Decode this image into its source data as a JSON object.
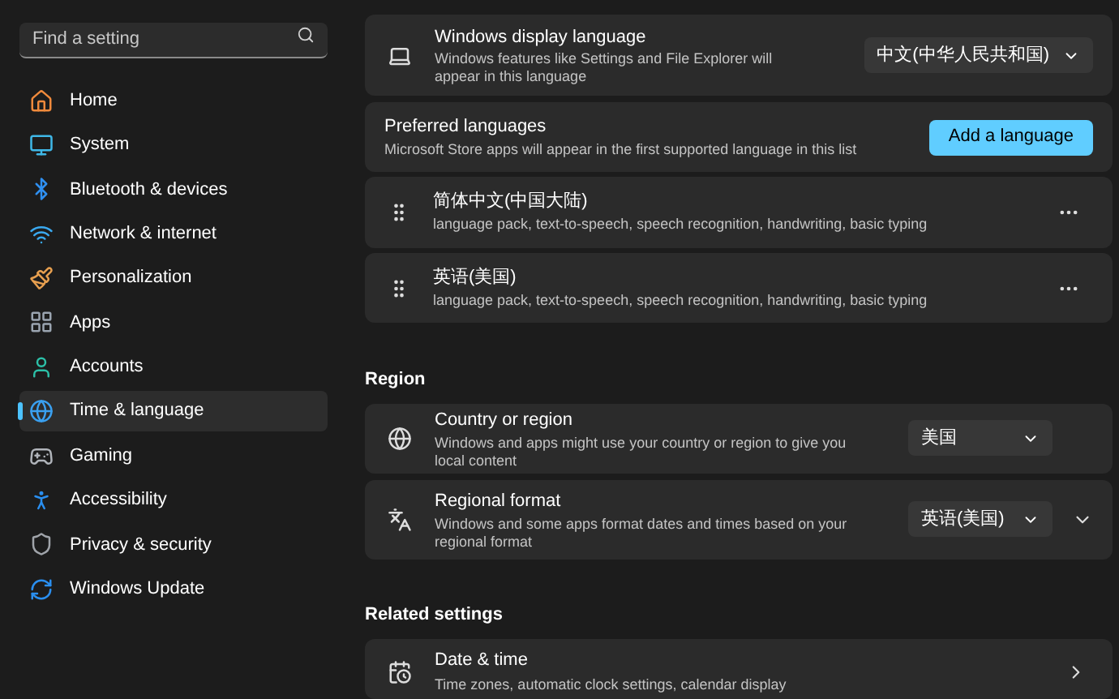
{
  "search": {
    "placeholder": "Find a setting"
  },
  "sidebar": {
    "items": [
      {
        "label": "Home",
        "selected": false
      },
      {
        "label": "System",
        "selected": false
      },
      {
        "label": "Bluetooth & devices",
        "selected": false
      },
      {
        "label": "Network & internet",
        "selected": false
      },
      {
        "label": "Personalization",
        "selected": false
      },
      {
        "label": "Apps",
        "selected": false
      },
      {
        "label": "Accounts",
        "selected": false
      },
      {
        "label": "Time & language",
        "selected": true
      },
      {
        "label": "Gaming",
        "selected": false
      },
      {
        "label": "Accessibility",
        "selected": false
      },
      {
        "label": "Privacy & security",
        "selected": false
      },
      {
        "label": "Windows Update",
        "selected": false
      }
    ]
  },
  "language": {
    "display_language": {
      "title": "Windows display language",
      "description": "Windows features like Settings and File Explorer will appear in this language",
      "value": "中文(中华人民共和国)"
    },
    "preferred": {
      "title": "Preferred languages",
      "description": "Microsoft Store apps will appear in the first supported language in this list",
      "button": "Add a language"
    },
    "languages": [
      {
        "name": "简体中文(中国大陆)",
        "features": "language pack, text-to-speech, speech recognition, handwriting, basic typing"
      },
      {
        "name": "英语(美国)",
        "features": "language pack, text-to-speech, speech recognition, handwriting, basic typing"
      }
    ]
  },
  "region": {
    "heading": "Region",
    "items": [
      {
        "kind": "country",
        "title": "Country or region",
        "description": "Windows and apps might use your country or region to give you local content",
        "value": "美国",
        "expandable": false
      },
      {
        "kind": "format",
        "title": "Regional format",
        "description": "Windows and some apps format dates and times based on your regional format",
        "value": "英语(美国)",
        "expandable": true
      }
    ]
  },
  "related": {
    "heading": "Related settings",
    "items": [
      {
        "title": "Date & time",
        "description": "Time zones, automatic clock settings, calendar display"
      }
    ]
  }
}
